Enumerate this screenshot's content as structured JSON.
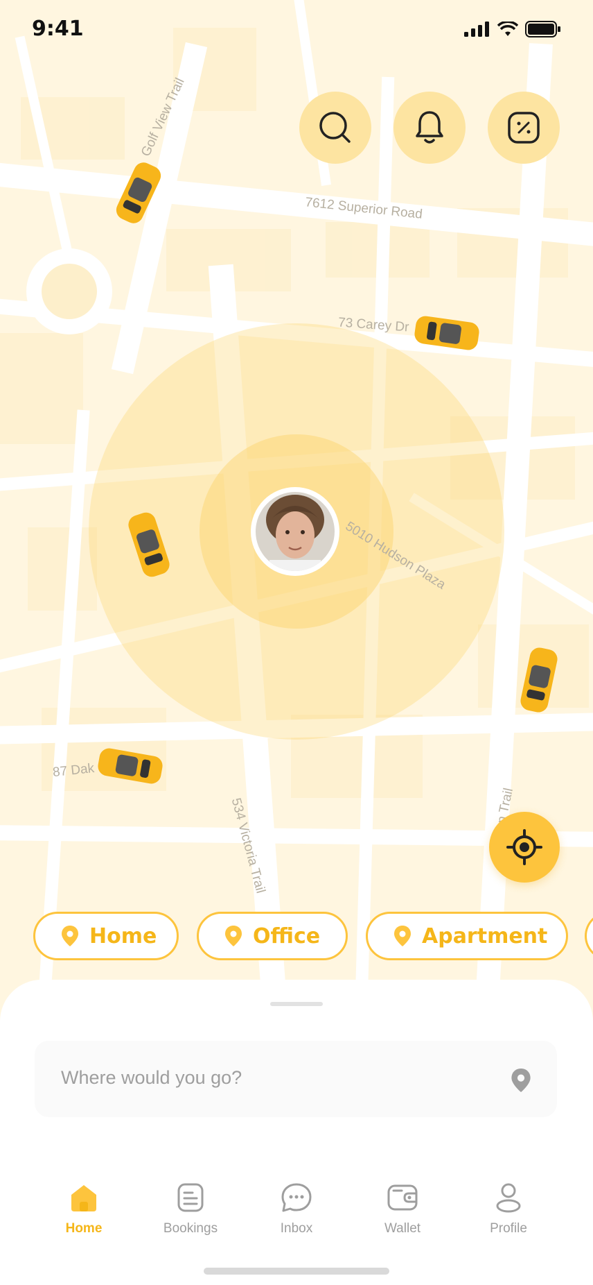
{
  "status_bar": {
    "time": "9:41"
  },
  "streets": [
    {
      "name": "Golf View Trail"
    },
    {
      "name": "7612 Superior Road"
    },
    {
      "name": "73 Carey Dr"
    },
    {
      "name": "5010 Hudson Plaza"
    },
    {
      "name": "87 Dak"
    },
    {
      "name": "534 Victoria Trail"
    },
    {
      "name": "Linden Trail"
    }
  ],
  "top_actions": {
    "search_icon": "search-icon",
    "notification_icon": "bell-icon",
    "discount_icon": "discount-icon"
  },
  "locate_icon": "crosshair-icon",
  "saved_places": [
    {
      "label": "Home"
    },
    {
      "label": "Office"
    },
    {
      "label": "Apartment"
    }
  ],
  "search": {
    "placeholder": "Where would you go?"
  },
  "tabs": [
    {
      "label": "Home",
      "icon": "home-icon",
      "active": true
    },
    {
      "label": "Bookings",
      "icon": "bookings-icon",
      "active": false
    },
    {
      "label": "Inbox",
      "icon": "chat-icon",
      "active": false
    },
    {
      "label": "Wallet",
      "icon": "wallet-icon",
      "active": false
    },
    {
      "label": "Profile",
      "icon": "profile-icon",
      "active": false
    }
  ],
  "colors": {
    "accent": "#FDC43D",
    "accent_text": "#F5B619",
    "map_bg": "#FFF6E0",
    "road": "#FFFFFF",
    "radar": "#FDD36B"
  }
}
